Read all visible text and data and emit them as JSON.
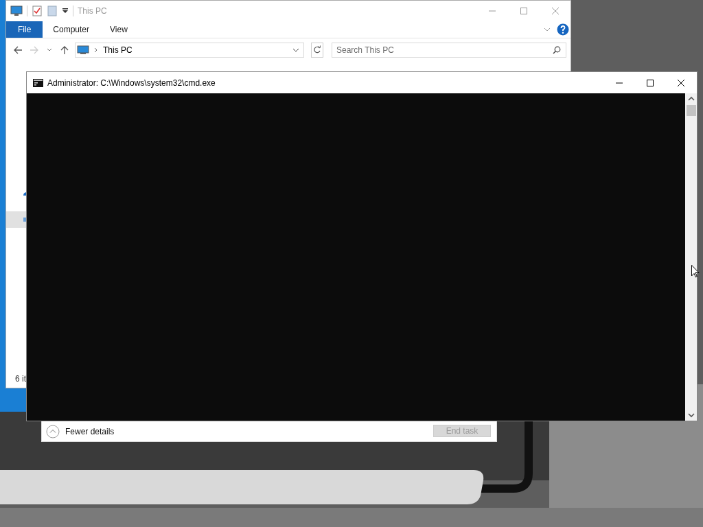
{
  "explorer": {
    "title": "This PC",
    "ribbon_tabs": [
      {
        "label": "File",
        "selected": true
      },
      {
        "label": "Computer",
        "selected": false
      },
      {
        "label": "View",
        "selected": false
      }
    ],
    "address": "This PC",
    "search": {
      "placeholder": "Search This PC"
    },
    "status_bar": "6 it"
  },
  "task_manager": {
    "details_toggle": "Fewer details",
    "end_task": {
      "label": "End task",
      "disabled": true
    }
  },
  "cmd": {
    "title": "Administrator: C:\\Windows\\system32\\cmd.exe"
  }
}
